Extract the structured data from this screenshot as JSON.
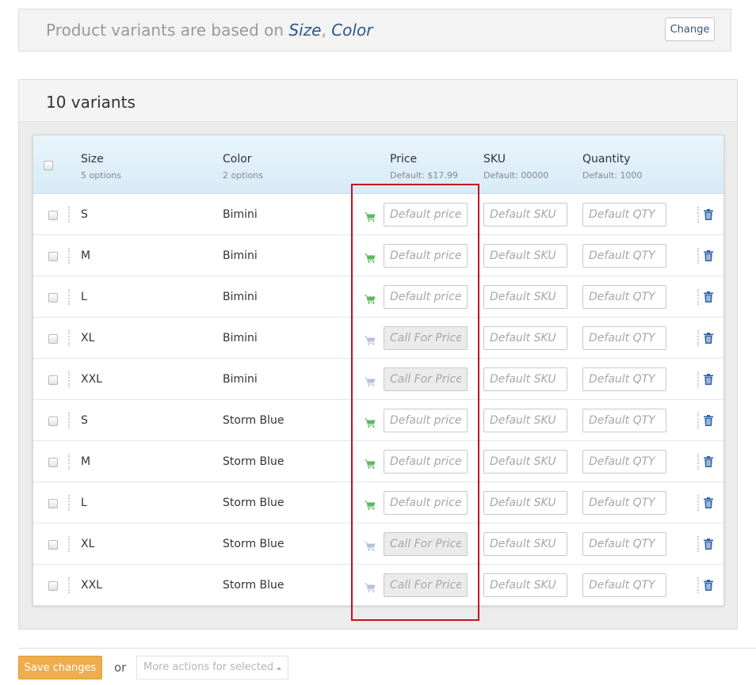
{
  "header": {
    "based_on_prefix": "Product variants are based on",
    "attributes": [
      "Size",
      "Color"
    ],
    "separator": ",",
    "change_label": "Change"
  },
  "variants": {
    "count_label": "10 variants",
    "columns": {
      "size": {
        "title": "Size",
        "subtitle": "5 options"
      },
      "color": {
        "title": "Color",
        "subtitle": "2 options"
      },
      "price": {
        "title": "Price",
        "subtitle": "Default: $17.99"
      },
      "sku": {
        "title": "SKU",
        "subtitle": "Default: 00000"
      },
      "quantity": {
        "title": "Quantity",
        "subtitle": "Default: 1000"
      }
    },
    "rows": [
      {
        "size": "S",
        "color": "Bimini",
        "price_placeholder": "Default price",
        "price_enabled": true,
        "sku_placeholder": "Default SKU",
        "qty_placeholder": "Default QTY"
      },
      {
        "size": "M",
        "color": "Bimini",
        "price_placeholder": "Default price",
        "price_enabled": true,
        "sku_placeholder": "Default SKU",
        "qty_placeholder": "Default QTY"
      },
      {
        "size": "L",
        "color": "Bimini",
        "price_placeholder": "Default price",
        "price_enabled": true,
        "sku_placeholder": "Default SKU",
        "qty_placeholder": "Default QTY"
      },
      {
        "size": "XL",
        "color": "Bimini",
        "price_placeholder": "Call For Price",
        "price_enabled": false,
        "sku_placeholder": "Default SKU",
        "qty_placeholder": "Default QTY"
      },
      {
        "size": "XXL",
        "color": "Bimini",
        "price_placeholder": "Call For Price",
        "price_enabled": false,
        "sku_placeholder": "Default SKU",
        "qty_placeholder": "Default QTY"
      },
      {
        "size": "S",
        "color": "Storm Blue",
        "price_placeholder": "Default price",
        "price_enabled": true,
        "sku_placeholder": "Default SKU",
        "qty_placeholder": "Default QTY"
      },
      {
        "size": "M",
        "color": "Storm Blue",
        "price_placeholder": "Default price",
        "price_enabled": true,
        "sku_placeholder": "Default SKU",
        "qty_placeholder": "Default QTY"
      },
      {
        "size": "L",
        "color": "Storm Blue",
        "price_placeholder": "Default price",
        "price_enabled": true,
        "sku_placeholder": "Default SKU",
        "qty_placeholder": "Default QTY"
      },
      {
        "size": "XL",
        "color": "Storm Blue",
        "price_placeholder": "Call For Price",
        "price_enabled": false,
        "sku_placeholder": "Default SKU",
        "qty_placeholder": "Default QTY"
      },
      {
        "size": "XXL",
        "color": "Storm Blue",
        "price_placeholder": "Call For Price",
        "price_enabled": false,
        "sku_placeholder": "Default SKU",
        "qty_placeholder": "Default QTY"
      }
    ]
  },
  "footer": {
    "save_label": "Save changes",
    "or_label": "or",
    "more_actions_label": "More actions for selected"
  },
  "icons": {
    "cart_enabled": "shopping-cart-icon",
    "cart_disabled": "shopping-cart-icon",
    "delete": "trash-icon"
  },
  "colors": {
    "cart_enabled": "#5cb85c",
    "cart_disabled": "#b7c2d8",
    "trash": "#2f63a8",
    "highlight": "#c8101e",
    "save_button": "#f0ad4e",
    "attribute_text": "#2a5a8a"
  }
}
